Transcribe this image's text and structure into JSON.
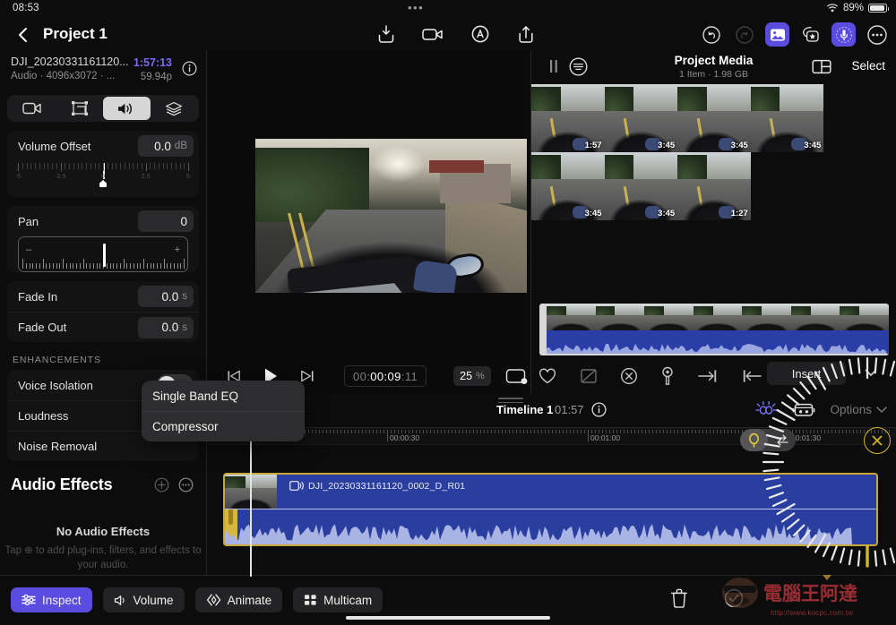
{
  "status": {
    "time": "08:53",
    "battery": "89%",
    "wifi_icon": "wifi-icon",
    "dots": "•••"
  },
  "topnav": {
    "back_icon": "chevron-left-icon",
    "title": "Project 1",
    "left_icons": [
      "import-icon",
      "record-video-icon",
      "voiceover-icon",
      "share-icon"
    ],
    "right_icons": [
      "undo-icon",
      "redo-icon",
      "media-browser-icon",
      "effects-browser-icon",
      "audio-browser-icon",
      "more-icon"
    ]
  },
  "inspector": {
    "clip_name": "DJI_20230331161120...",
    "timecode": "1:57:13",
    "subtitle": "Audio · 4096x3072 · ...",
    "fps": "59.94p",
    "info_icon": "info-icon",
    "tabs": [
      {
        "name": "video-tab",
        "icon": "video-camera-icon",
        "active": false
      },
      {
        "name": "transform-tab",
        "icon": "transform-icon",
        "active": false
      },
      {
        "name": "audio-tab",
        "icon": "speaker-icon",
        "active": true
      },
      {
        "name": "effects-tab",
        "icon": "layers-icon",
        "active": false
      }
    ],
    "volume_offset": {
      "label": "Volume Offset",
      "value": "0.0",
      "unit": "dB",
      "ticks": [
        "-5",
        "-2.5",
        "0",
        "2.5",
        "5"
      ]
    },
    "pan": {
      "label": "Pan",
      "value": "0",
      "minus": "–",
      "plus": "+"
    },
    "fade_in": {
      "label": "Fade In",
      "value": "0.0",
      "unit": "s"
    },
    "fade_out": {
      "label": "Fade Out",
      "value": "0.0",
      "unit": "s"
    },
    "enhancements_title": "ENHANCEMENTS",
    "enhancements": [
      {
        "label": "Voice Isolation",
        "toggle": "off"
      },
      {
        "label": "Loudness"
      },
      {
        "label": "Noise Removal"
      }
    ],
    "audio_effects": {
      "title": "Audio Effects",
      "add_icon": "plus-circle-icon",
      "more_icon": "more-circle-icon",
      "empty_title": "No Audio Effects",
      "empty_body": "Tap ⊕ to add plug-ins, filters, and effects to your audio."
    }
  },
  "popup_menu": {
    "name": "audio-effects-menu",
    "items": [
      "Single Band EQ",
      "Compressor"
    ]
  },
  "viewer": {
    "transport": {
      "prev_icon": "skip-to-start-icon",
      "play_icon": "play-icon",
      "next_icon": "skip-to-end-icon",
      "timecode": "00:00:09:11",
      "timecode_dim_head": "00:",
      "timecode_bright": "00:09",
      "timecode_dim_tail": ":11",
      "zoom": "25",
      "zoom_unit": "%",
      "viewer_options_icon": "viewer-options-icon"
    }
  },
  "browser": {
    "pause_icon": "pause-icon",
    "filter_icon": "filter-icon",
    "title": "Project Media",
    "subtitle": "1 Item  ·  1.98 GB",
    "layout_icon": "layout-icon",
    "select_label": "Select",
    "thumbnails": [
      {
        "duration": "1:57",
        "selected": true
      },
      {
        "duration": "3:45",
        "selected": false
      },
      {
        "duration": "3:45",
        "selected": false
      },
      {
        "duration": "3:45",
        "selected": false
      },
      {
        "duration": "3:45",
        "selected": false
      },
      {
        "duration": "3:45",
        "selected": false
      },
      {
        "duration": "1:27",
        "selected": false
      }
    ],
    "tool_icons": [
      "favorite-icon",
      "reject-icon",
      "unrate-icon",
      "keyword-icon",
      "mark-in-icon",
      "mark-out-icon"
    ],
    "insert_label": "Insert",
    "insert_chevron_icon": "chevron-down-icon"
  },
  "timeline": {
    "name": "Timeline 1",
    "duration": "01:57",
    "info_icon": "info-icon",
    "snap_icon": "snapping-icon",
    "effects_icon": "timeline-effects-icon",
    "options_label": "Options",
    "options_chevron_icon": "chevron-down-icon",
    "ruler_labels": [
      "00:00:30",
      "00:01:00",
      "00:01:30"
    ],
    "skim_toggle": {
      "lasso_icon": "lasso-icon",
      "swap-icon": "swap-icon"
    },
    "clip": {
      "name": "DJI_20230331161120_0002_D_R01",
      "audio_icon": "video-audio-icon"
    }
  },
  "jog_dial": {
    "name": "jog-wheel",
    "close_icon": "close-x-icon",
    "accent": "#d4b62e"
  },
  "bottombar": {
    "left_buttons": [
      {
        "label": "Inspect",
        "icon": "sliders-icon",
        "active": true
      },
      {
        "label": "Volume",
        "icon": "volume-icon",
        "active": false
      },
      {
        "label": "Animate",
        "icon": "keyframe-icon",
        "active": false
      },
      {
        "label": "Multicam",
        "icon": "grid-icon",
        "active": false
      }
    ],
    "right_icons": [
      "trash-icon",
      "check-circle-icon"
    ]
  },
  "watermark": {
    "url": "http://www.kocpc.com.tw"
  },
  "colors": {
    "accent": "#5b4ce0",
    "clip_blue": "#2a3ea0",
    "clip_border": "#c9a83a",
    "dial": "#d4b62e"
  }
}
